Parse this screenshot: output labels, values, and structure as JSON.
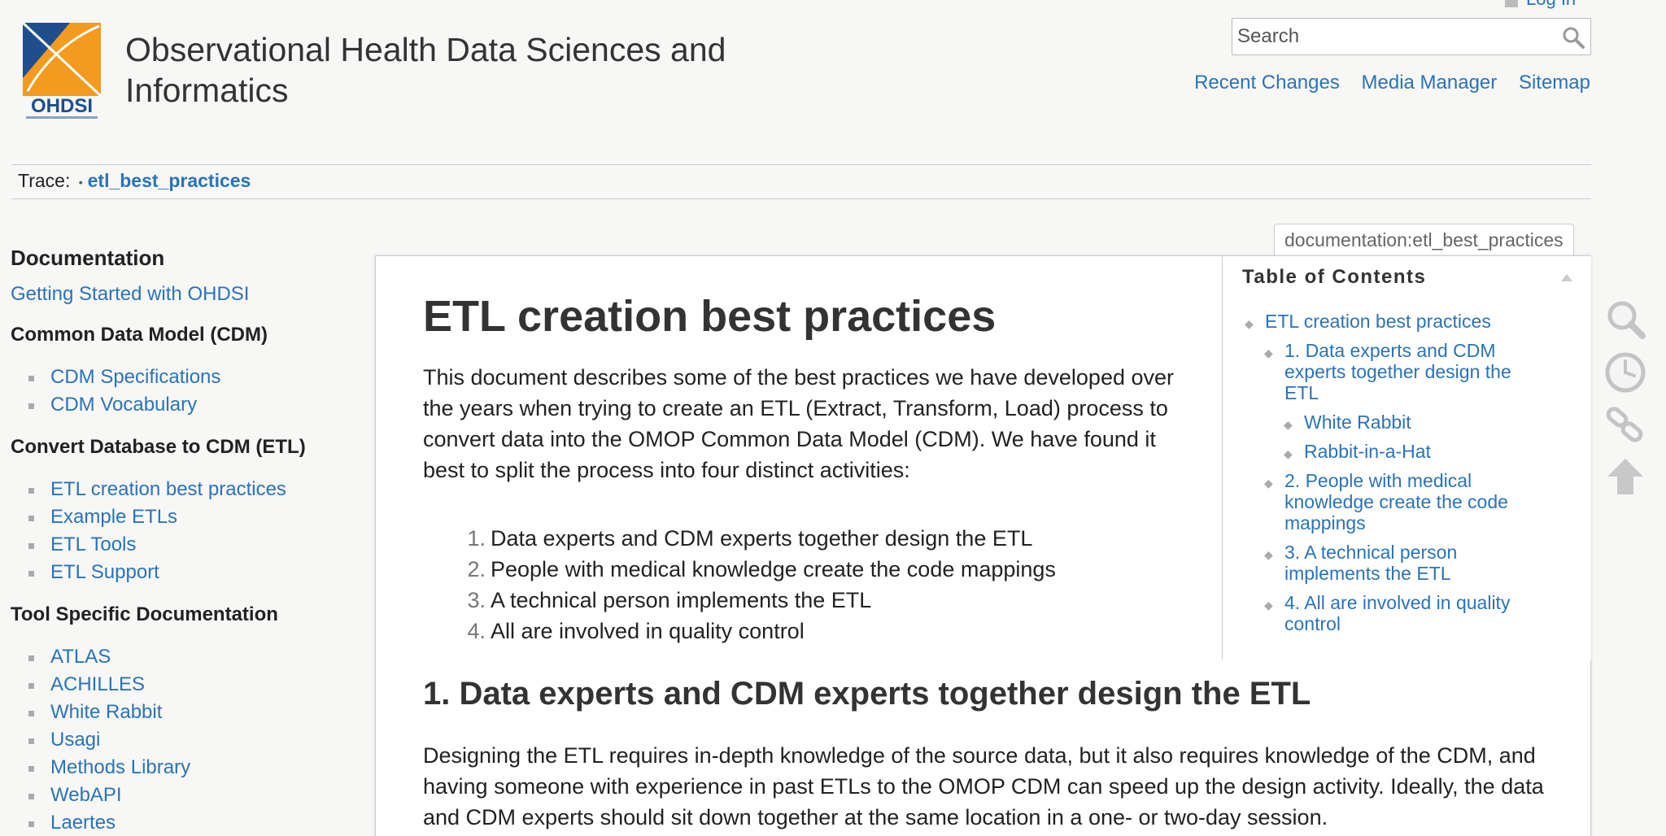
{
  "header": {
    "site_title": "Observational Health Data Sciences and Informatics",
    "logo_text": "OHDSI",
    "login_label": "Log In",
    "search_placeholder": "Search",
    "nav": [
      "Recent Changes",
      "Media Manager",
      "Sitemap"
    ]
  },
  "breadcrumb": {
    "label": "Trace:",
    "separator": "•",
    "page": "etl_best_practices"
  },
  "sidebar": {
    "title": "Documentation",
    "getting_started": "Getting Started with OHDSI",
    "sections": [
      {
        "title": "Common Data Model (CDM)",
        "items": [
          "CDM Specifications",
          "CDM Vocabulary"
        ]
      },
      {
        "title": "Convert Database to CDM (ETL)",
        "items": [
          "ETL creation best practices",
          "Example ETLs",
          "ETL Tools",
          "ETL Support"
        ]
      },
      {
        "title": "Tool Specific Documentation",
        "items": [
          "ATLAS",
          "ACHILLES",
          "White Rabbit",
          "Usagi",
          "Methods Library",
          "WebAPI",
          "Laertes"
        ]
      }
    ]
  },
  "page": {
    "id": "documentation:etl_best_practices",
    "title": "ETL creation best practices",
    "intro": "This document describes some of the best practices we have developed over the years when trying to create an ETL (Extract, Transform, Load) process to convert data into the OMOP Common Data Model (CDM). We have found it best to split the process into four distinct activities:",
    "steps": [
      {
        "num": "1.",
        "text": "Data experts and CDM experts together design the ETL"
      },
      {
        "num": "2.",
        "text": "People with medical knowledge create the code mappings"
      },
      {
        "num": "3.",
        "text": "A technical person implements the ETL"
      },
      {
        "num": "4.",
        "text": "All are involved in quality control"
      }
    ],
    "section1_heading": "1. Data experts and CDM experts together design the ETL",
    "section1_text": "Designing the ETL requires in-depth knowledge of the source data, but it also requires knowledge of the CDM, and having someone with experience in past ETLs to the OMOP CDM can speed up the design activity. Ideally, the data and CDM experts should sit down together at the same location in a one- or two-day session."
  },
  "toc": {
    "title": "Table of Contents",
    "items": [
      {
        "level": 1,
        "lines": [
          "ETL creation best practices"
        ]
      },
      {
        "level": 2,
        "lines": [
          "1. Data experts and CDM",
          "experts together design the",
          "ETL"
        ]
      },
      {
        "level": 3,
        "lines": [
          "White Rabbit"
        ]
      },
      {
        "level": 3,
        "lines": [
          "Rabbit-in-a-Hat"
        ]
      },
      {
        "level": 2,
        "lines": [
          "2. People with medical",
          "knowledge create the code",
          "mappings"
        ]
      },
      {
        "level": 2,
        "lines": [
          "3. A technical person",
          "implements the ETL"
        ]
      },
      {
        "level": 2,
        "lines": [
          "4. All are involved in quality",
          "control"
        ]
      }
    ]
  },
  "tools": [
    "search-icon",
    "clock-icon",
    "link-icon",
    "arrow-up-icon"
  ],
  "colors": {
    "link": "#2b73b7",
    "logo_orange": "#f39a1f",
    "logo_blue": "#1e4e8c"
  }
}
